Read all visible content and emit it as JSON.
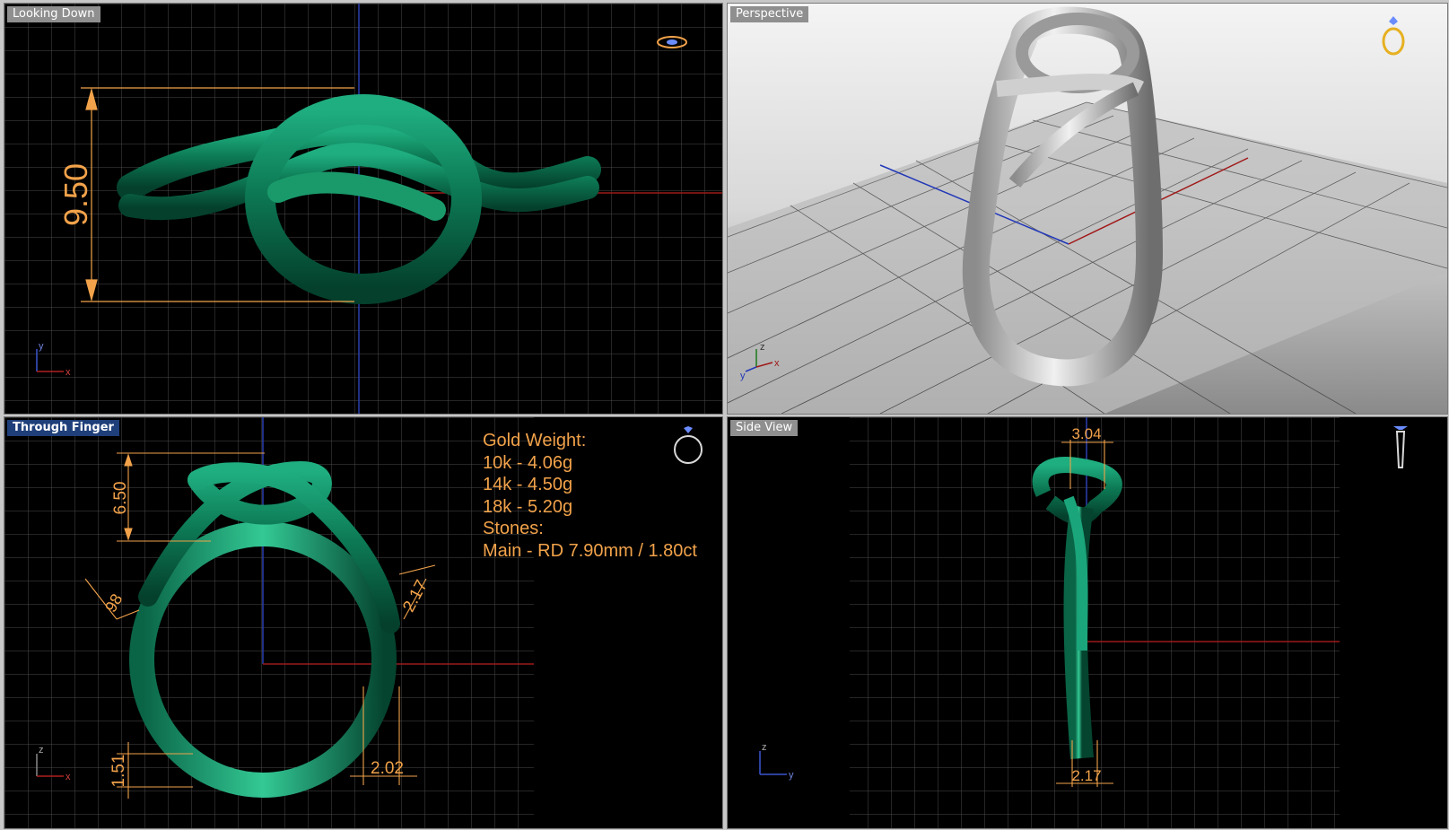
{
  "viewports": {
    "top_left": {
      "title": "Looking Down",
      "dimension": "9.50",
      "axes": [
        "y",
        "x"
      ]
    },
    "top_right": {
      "title": "Perspective",
      "axes": [
        "z",
        "y",
        "x"
      ]
    },
    "bottom_left": {
      "title": "Through Finger",
      "axes": [
        "z",
        "x"
      ],
      "dimensions": {
        "head_height": "6.50",
        "shank_left": "98",
        "shank_right": "2.17",
        "bottom_height": "1.51",
        "bottom_width": "2.02"
      },
      "info": {
        "gold_weight_label": "Gold Weight:",
        "w10k": "10k - 4.06g",
        "w14k": "14k - 4.50g",
        "w18k": "18k - 5.20g",
        "stones_label": "Stones:",
        "main_stone": "Main - RD 7.90mm / 1.80ct"
      }
    },
    "bottom_right": {
      "title": "Side View",
      "dimension_top": "3.04",
      "dimension_bottom": "2.17",
      "axes": [
        "z",
        "y"
      ]
    }
  },
  "colors": {
    "ring_green": "#0f7a56",
    "dimension_orange": "#f2a24a",
    "active_title": "#1f3f7a",
    "inactive_title": "#8f8f8f"
  },
  "icons": [
    "ring-top-view-icon",
    "ring-perspective-icon",
    "ring-front-view-icon",
    "ring-side-view-icon"
  ]
}
